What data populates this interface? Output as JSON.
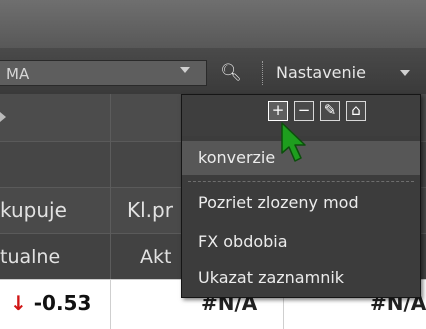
{
  "toolbar": {
    "combo_value": "MA",
    "settings_label": "Nastavenie"
  },
  "grid": {
    "header_row": {
      "col1": "kupuje",
      "col2": "Kl.pr"
    },
    "subheader_row": {
      "col1": "tualne",
      "col2": "Akt"
    },
    "data_row": {
      "change_arrow": "↓",
      "change_value": "-0.53",
      "col2": "#N/A",
      "col3": "#N/A"
    }
  },
  "popup": {
    "icons": [
      {
        "glyph": "+",
        "name": "add"
      },
      {
        "glyph": "−",
        "name": "remove"
      },
      {
        "glyph": "✎",
        "name": "edit"
      },
      {
        "glyph": "⌂",
        "name": "home"
      }
    ],
    "items": [
      "konverzie",
      "Pozriet zlozeny mod",
      "FX obdobia",
      "Ukazat zaznamnik"
    ]
  },
  "colors": {
    "down_arrow": "#d01515",
    "cursor": "#1e9e1e"
  }
}
